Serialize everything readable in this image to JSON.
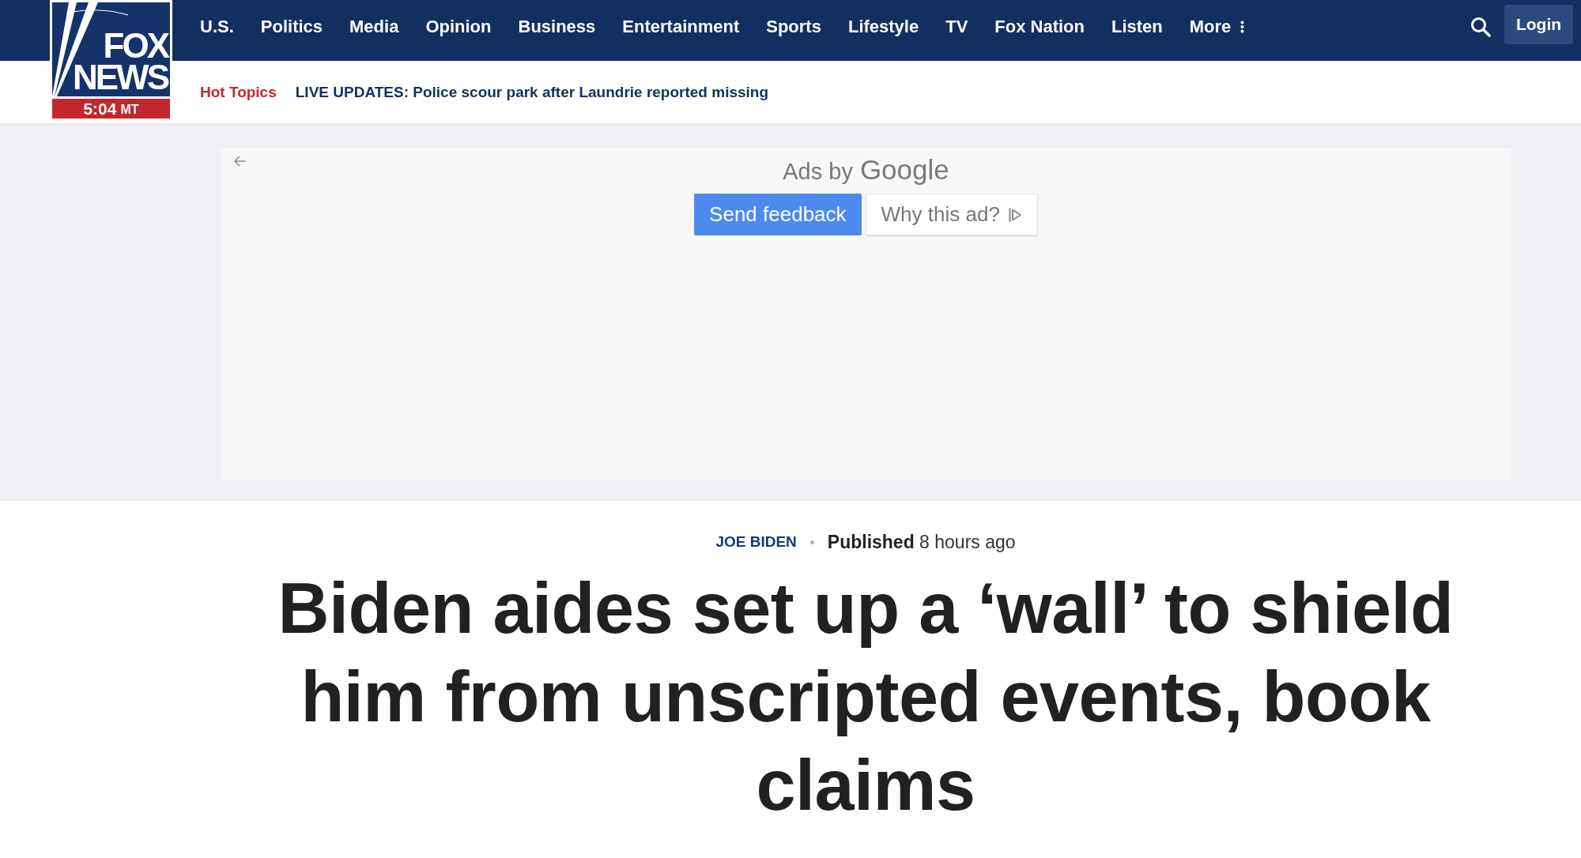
{
  "header": {
    "logo": {
      "line_1": "FOX",
      "line_2": "NEWS",
      "time": "5:04",
      "zone": "MT"
    },
    "nav": [
      {
        "label": "U.S.",
        "kind": "link"
      },
      {
        "label": "Politics",
        "kind": "link"
      },
      {
        "label": "Media",
        "kind": "link"
      },
      {
        "label": "Opinion",
        "kind": "link"
      },
      {
        "label": "Business",
        "kind": "link"
      },
      {
        "label": "Entertainment",
        "kind": "link"
      },
      {
        "label": "Sports",
        "kind": "link"
      },
      {
        "label": "Lifestyle",
        "kind": "link"
      },
      {
        "label": "TV",
        "kind": "link"
      },
      {
        "label": "Fox Nation",
        "kind": "link"
      },
      {
        "label": "Listen",
        "kind": "link"
      },
      {
        "label": "More",
        "kind": "menu"
      }
    ],
    "login_button": "Login",
    "hot_topics": {
      "label": "Hot Topics",
      "headline": "LIVE UPDATES: Police scour park after Laundrie reported missing"
    }
  },
  "ad": {
    "label": "Ads by",
    "brand": "Google",
    "buttons": [
      {
        "label": "Send feedback",
        "kind": "primary"
      },
      {
        "label": "Why this ad?",
        "kind": "secondary"
      }
    ]
  },
  "article": {
    "category": "JOE BIDEN",
    "published": "**Published** 8 hours ago",
    "headline": "Biden aides set up a ‘wall’ to shield him from unscripted events, book claims"
  }
}
